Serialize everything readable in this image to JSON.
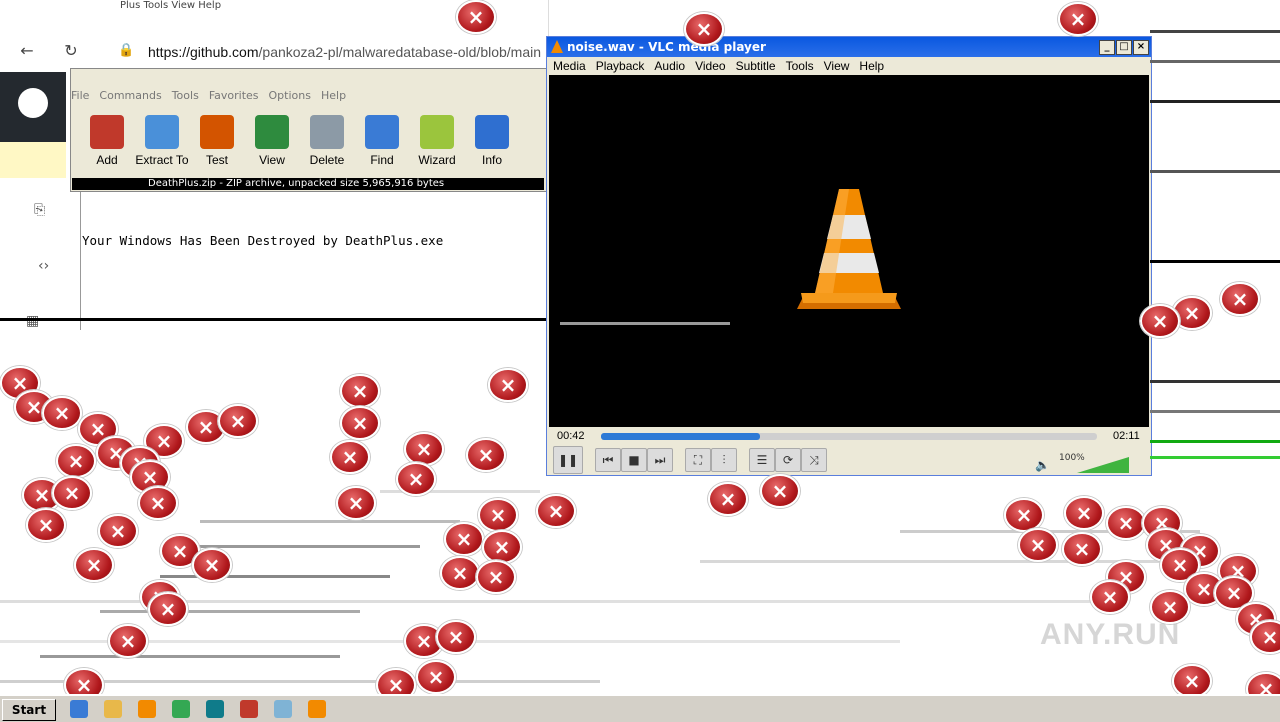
{
  "browser": {
    "top_menu_fragment": "Plus  Tools  View  Help",
    "url_host": "https://github.com",
    "url_path": "/pankoza2-pl/malwaredatabase-old/blob/main"
  },
  "winrar": {
    "menu": [
      "File",
      "Commands",
      "Tools",
      "Favorites",
      "Options",
      "Help"
    ],
    "tools": [
      {
        "label": "Add",
        "icon": "archive-add-icon",
        "color": "#c0392b"
      },
      {
        "label": "Extract To",
        "icon": "folder-extract-icon",
        "color": "#4a90d9"
      },
      {
        "label": "Test",
        "icon": "clipboard-test-icon",
        "color": "#d35400"
      },
      {
        "label": "View",
        "icon": "book-view-icon",
        "color": "#2e8b3e"
      },
      {
        "label": "Delete",
        "icon": "trash-icon",
        "color": "#8c9aa6"
      },
      {
        "label": "Find",
        "icon": "magnifier-icon",
        "color": "#3a7bd5"
      },
      {
        "label": "Wizard",
        "icon": "wand-icon",
        "color": "#9bc53d"
      },
      {
        "label": "Info",
        "icon": "info-icon",
        "color": "#2f6fd0"
      }
    ],
    "status": "DeathPlus.zip - ZIP archive, unpacked size 5,965,916 bytes"
  },
  "notepad": {
    "text": "Your Windows Has Been Destroyed by DeathPlus.exe"
  },
  "vlc": {
    "title": "noise.wav - VLC media player",
    "menu": [
      "Media",
      "Playback",
      "Audio",
      "Video",
      "Subtitle",
      "Tools",
      "View",
      "Help"
    ],
    "time_current": "00:42",
    "time_total": "02:11",
    "progress": 0.32,
    "volume_label": "100%",
    "volume": 1.0,
    "accent": "#2d7ad6"
  },
  "taskbar": {
    "start_label": "Start",
    "icons": [
      "ie-icon",
      "explorer-icon",
      "media-player-icon",
      "chrome-icon",
      "edge-icon",
      "winrar-icon",
      "notepad-icon",
      "vlc-icon"
    ]
  },
  "watermark": "ANY.RUN",
  "colors": {
    "error_red": "#b0171b",
    "vlc_orange": "#f28a00"
  }
}
